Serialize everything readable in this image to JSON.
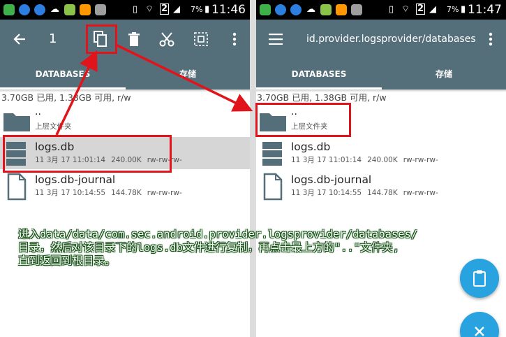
{
  "status_left": {
    "time": "11:46",
    "signal_digit": "2",
    "battery": "7%"
  },
  "status_right": {
    "time": "11:47",
    "signal_digit": "2",
    "battery": "7%"
  },
  "left": {
    "selection_count": "1",
    "tabs": [
      {
        "label": "DATABASES",
        "active": true
      },
      {
        "label": "存储",
        "active": false
      }
    ],
    "storage_info": "3.70GB 已用, 1.38GB 可用, r/w",
    "items": [
      {
        "name": "..",
        "subtitle": "上层文件夹",
        "icon": "folder-icon"
      },
      {
        "name": "logs.db",
        "date": "11 3月 17 11:01:14",
        "size": "240.00K",
        "perms": "rw-rw-rw-",
        "icon": "database-icon",
        "selected": true
      },
      {
        "name": "logs.db-journal",
        "date": "11 3月 17 10:14:55",
        "size": "144.78K",
        "perms": "rw-rw-rw-",
        "icon": "file-icon"
      }
    ]
  },
  "right": {
    "title": "id.provider.logsprovider/databases",
    "tabs": [
      {
        "label": "DATABASES",
        "active": true
      },
      {
        "label": "存储",
        "active": false
      }
    ],
    "storage_info": "3.70GB 已用, 1.38GB 可用, r/w",
    "items": [
      {
        "name": "..",
        "subtitle": "上层文件夹",
        "icon": "folder-icon"
      },
      {
        "name": "logs.db",
        "date": "11 3月 17 11:01:14",
        "size": "240.00K",
        "perms": "rw-rw-rw-",
        "icon": "database-icon"
      },
      {
        "name": "logs.db-journal",
        "date": "11 3月 17 10:14:55",
        "size": "144.78K",
        "perms": "rw-rw-rw-",
        "icon": "file-icon"
      }
    ]
  },
  "caption": [
    "进入data/data/com.sec.android.provider.logsprovider/databases/",
    "目录，然后对该目录下的logs.db文件进行复制，再点击最上方的\"..\"文件夹,",
    "直到返回到根目录。"
  ],
  "colors": {
    "toolbar": "#546e7a",
    "highlight": "#e0141a",
    "fab": "#29a3e0",
    "selected_row": "#d6d6d6"
  }
}
